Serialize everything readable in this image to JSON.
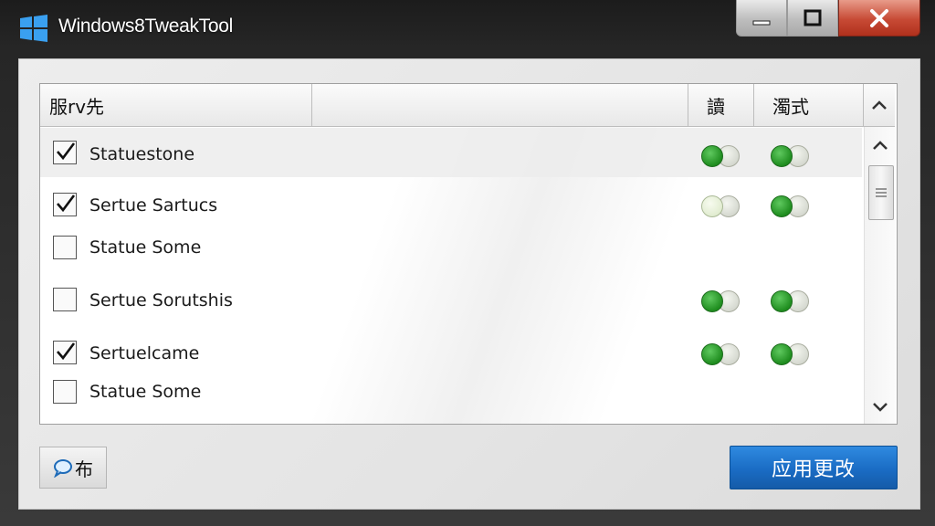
{
  "window": {
    "title": "Windows8TweakTool",
    "controls": [
      "minimize",
      "maximize",
      "close"
    ]
  },
  "listview": {
    "columns": [
      {
        "label": "服rv先"
      },
      {
        "label": ""
      },
      {
        "label": "讀"
      },
      {
        "label": "濁式"
      }
    ],
    "rows": [
      {
        "label": "Statuestone",
        "checked": true,
        "toggle1": "on",
        "toggle2": "on",
        "selected": true
      },
      {
        "label": "Sertue Sartucs",
        "checked": true,
        "toggle1": "off",
        "toggle2": "on",
        "selected": false
      },
      {
        "label": "Statue Some",
        "checked": false,
        "toggle1": null,
        "toggle2": null,
        "selected": false
      },
      {
        "label": "Sertue Sorutshis",
        "checked": false,
        "toggle1": "on",
        "toggle2": "on",
        "selected": false
      },
      {
        "label": "Sertuelcame",
        "checked": true,
        "toggle1": "on",
        "toggle2": "on",
        "selected": false
      },
      {
        "label": "Statue Some",
        "checked": false,
        "toggle1": null,
        "toggle2": null,
        "selected": false
      }
    ]
  },
  "buttons": {
    "language_label": "布",
    "apply_label": "应用更改"
  },
  "colors": {
    "accent": "#1a6cc4",
    "toggle_on": "#2a9a2a",
    "close": "#c74a35"
  }
}
